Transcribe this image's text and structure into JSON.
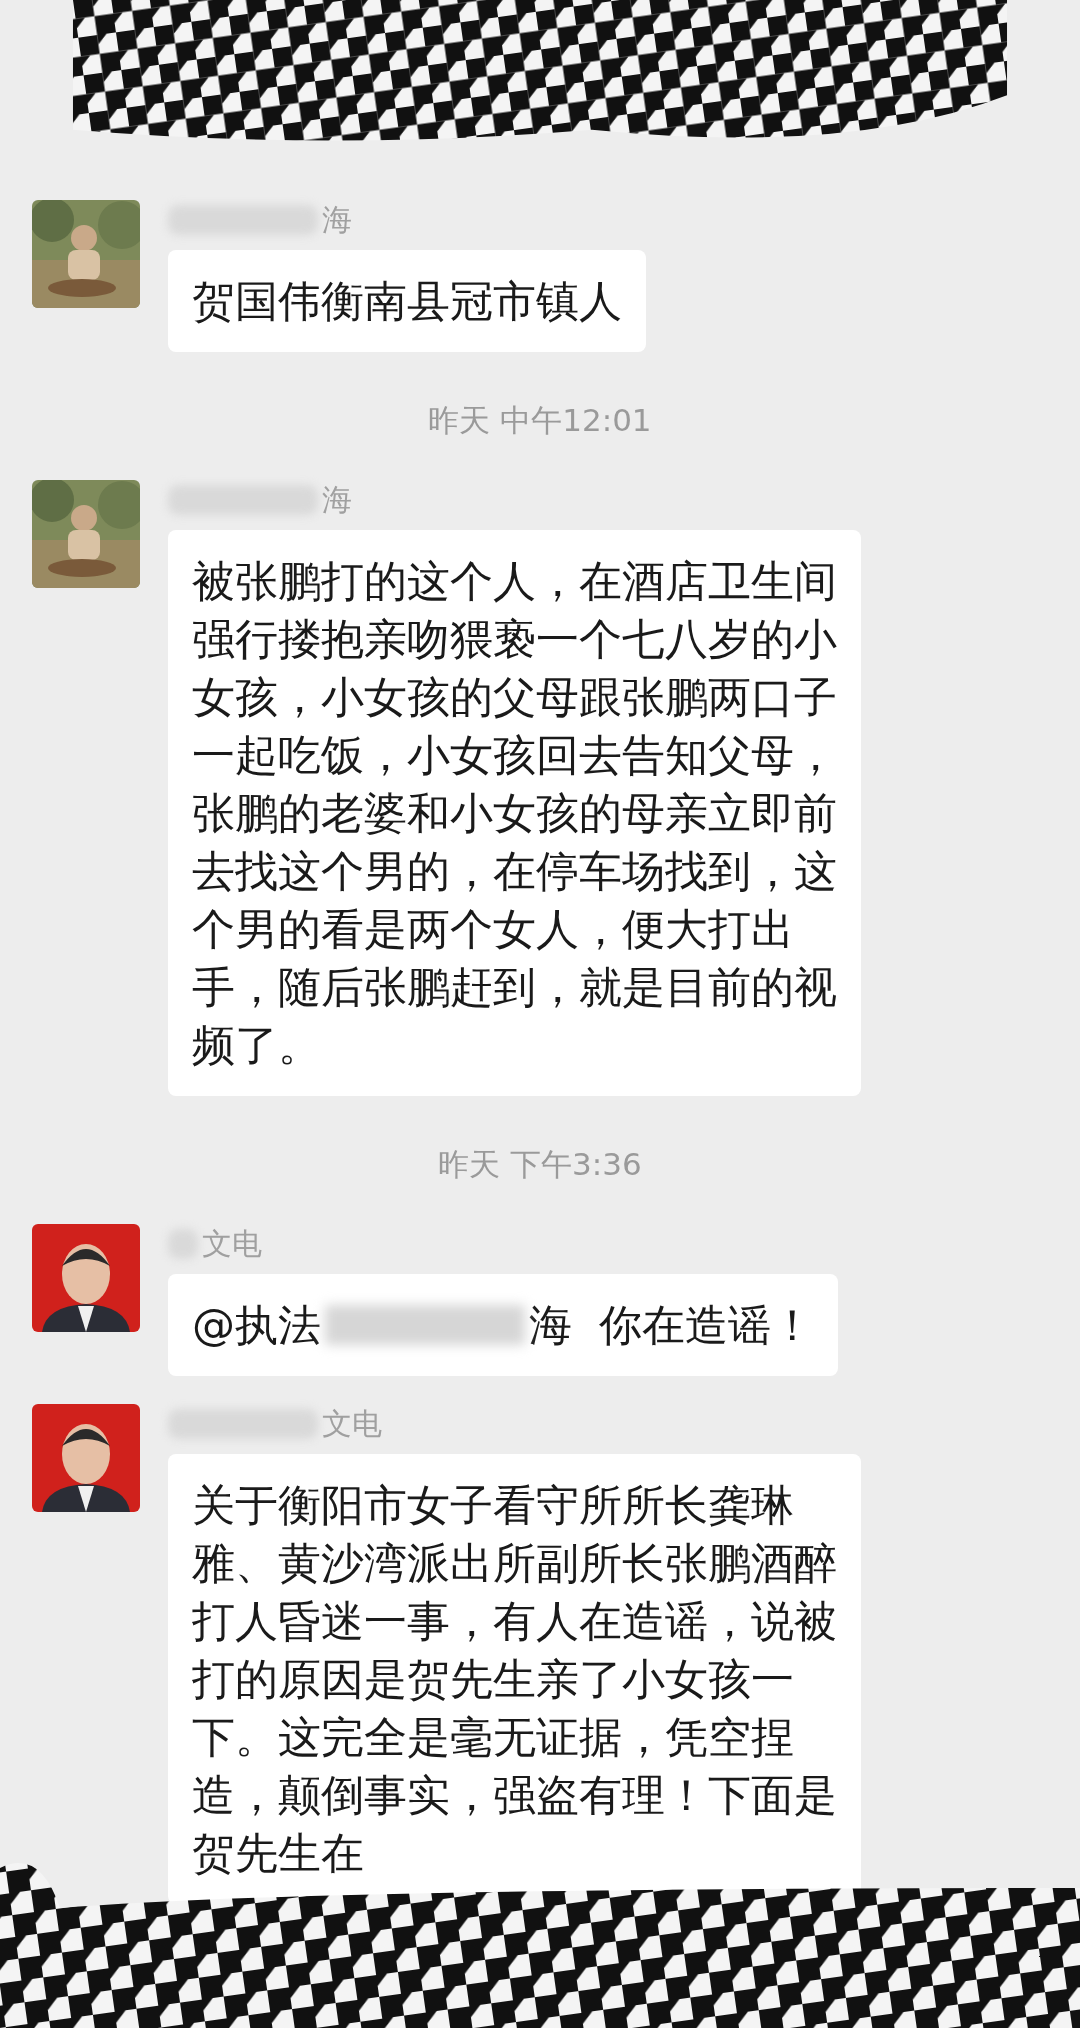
{
  "items": [
    {
      "kind": "message",
      "sender": "海",
      "sender_blurred": true,
      "text": "贺国伟衡南县冠市镇人"
    },
    {
      "kind": "time",
      "text": "昨天 中午12:01"
    },
    {
      "kind": "message",
      "sender": "海",
      "sender_blurred": true,
      "text": "被张鹏打的这个人，在酒店卫生间强行搂抱亲吻猥亵一个七八岁的小女孩，小女孩的父母跟张鹏两口子一起吃饭，小女孩回去告知父母，张鹏的老婆和小女孩的母亲立即前去找这个男的，在停车场找到，这个男的看是两个女人，便大打出手，随后张鹏赶到，就是目前的视频了。"
    },
    {
      "kind": "time",
      "text": "昨天 下午3:36"
    },
    {
      "kind": "message",
      "avatar": {
        "kind": "portrait"
      },
      "sender": "文电",
      "sender_blurred": true,
      "mention": "@执法",
      "text": "海  你在造谣！"
    },
    {
      "kind": "message",
      "avatar": {
        "kind": "portrait"
      },
      "sender": "文电",
      "sender_blurred": true,
      "text": "关于衡阳市女子看守所所长龚琳雅、黄沙湾派出所副所长张鹏酒醉打人昏迷一事，有人在造谣，说被打的原因是贺先生亲了小女孩一下。这完全是毫无证据，凭空捏造，颠倒事实，强盗有理！下面是贺先生在"
    }
  ]
}
